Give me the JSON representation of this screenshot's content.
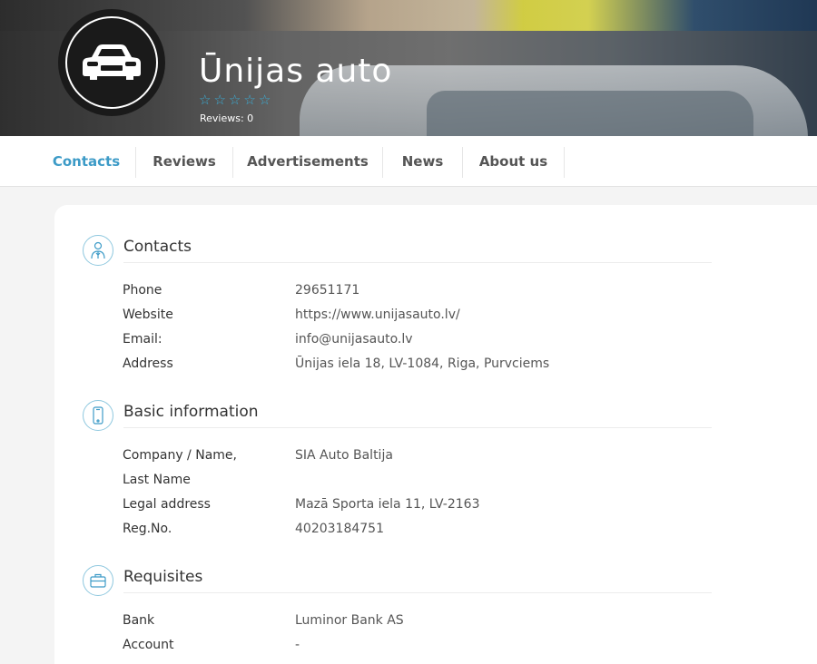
{
  "header": {
    "company_name": "Ūnijas auto",
    "rating_stars": 0,
    "rating_max": 5,
    "reviews_label": "Reviews: 0"
  },
  "nav": {
    "tabs": [
      {
        "label": "Contacts",
        "active": true
      },
      {
        "label": "Reviews",
        "active": false
      },
      {
        "label": "Advertisements",
        "active": false
      },
      {
        "label": "News",
        "active": false
      },
      {
        "label": "About us",
        "active": false
      }
    ]
  },
  "sections": {
    "contacts": {
      "title": "Contacts",
      "icon": "person-icon",
      "rows": [
        {
          "label": "Phone",
          "value": "29651171"
        },
        {
          "label": "Website",
          "value": "https://www.unijasauto.lv/"
        },
        {
          "label": "Email:",
          "value": "info@unijasauto.lv"
        },
        {
          "label": "Address",
          "value": "Ūnijas iela 18, LV-1084, Riga, Purvciems"
        }
      ]
    },
    "basic": {
      "title": "Basic information",
      "icon": "phone-icon",
      "rows": [
        {
          "label": "Company / Name,",
          "value": "SIA Auto Baltija"
        },
        {
          "label": "Last Name",
          "value": ""
        },
        {
          "label": "Legal address",
          "value": "Mazā Sporta iela 11, LV-2163"
        },
        {
          "label": "Reg.No.",
          "value": "40203184751"
        }
      ]
    },
    "requisites": {
      "title": "Requisites",
      "icon": "briefcase-icon",
      "rows": [
        {
          "label": "Bank",
          "value": "Luminor Bank AS"
        },
        {
          "label": "Account",
          "value": "-"
        }
      ]
    }
  },
  "colors": {
    "accent": "#3d9bc7",
    "star": "#3aaed8",
    "text": "#333333"
  }
}
